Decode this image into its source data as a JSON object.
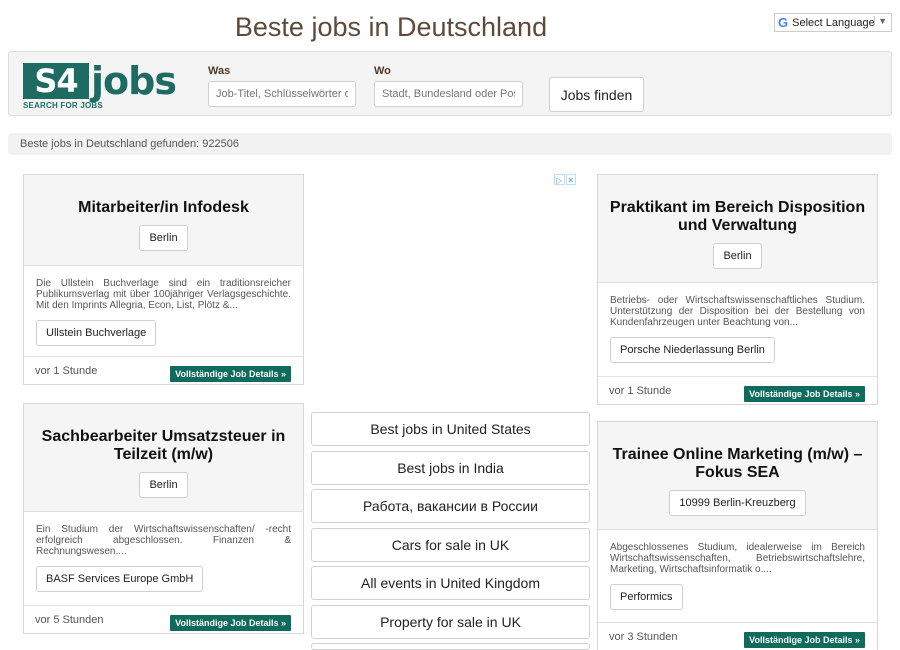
{
  "header": {
    "title": "Beste jobs in Deutschland"
  },
  "language": {
    "label": "Select Language"
  },
  "logo": {
    "main": "S4",
    "suffix": "jobs",
    "tagline": "SEARCH FOR JOBS"
  },
  "search": {
    "what_label": "Was",
    "what_placeholder": "Job-Titel, Schlüsselwörter o",
    "where_label": "Wo",
    "where_placeholder": "Stadt, Bundesland oder Pos",
    "button": "Jobs finden"
  },
  "results": {
    "text": "Beste jobs in Deutschland gefunden: 922506"
  },
  "details_label": "Vollständige Job Details »",
  "jobs": [
    {
      "title": "Mitarbeiter/in Infodesk",
      "location": "Berlin",
      "description": "Die Ullstein Buchverlage sind ein traditionsreicher Publikumsverlag mit über 100jähriger Verlagsgeschichte. Mit den Imprints Allegria, Econ, List, Plötz &...",
      "company": "Ullstein Buchverlage",
      "time": "vor 1 Stunde"
    },
    {
      "title": "Sachbearbeiter Umsatzsteuer in Teilzeit (m/w)",
      "location": "Berlin",
      "description": "Ein Studium der Wirtschaftswissenschaften/ -recht erfolgreich abgeschlossen. Finanzen & Rechnungswesen....",
      "company": "BASF Services Europe GmbH",
      "time": "vor 5 Stunden"
    },
    {
      "title": "Praktikant im Bereich Disposition und Verwaltung",
      "location": "Berlin",
      "description": "Betriebs- oder Wirtschaftswissenschaftliches Studium. Unterstützung der Disposition bei der Bestellung von Kundenfahrzeugen unter Beachtung von...",
      "company": "Porsche Niederlassung Berlin",
      "time": "vor 1 Stunde"
    },
    {
      "title": "Trainee Online Marketing (m/w) – Fokus SEA",
      "location": "10999 Berlin-Kreuzberg",
      "description": "Abgeschlossenes Studium, idealerweise im Bereich Wirtschaftswissenschaften, Betriebswirtschaftslehre, Marketing, Wirtschaftsinformatik o....",
      "company": "Performics",
      "time": "vor 3 Stunden"
    }
  ],
  "links": [
    "Best jobs in United States",
    "Best jobs in India",
    "Работа, вакансии в России",
    "Cars for sale in UK",
    "All events in United Kingdom",
    "Property for sale in UK"
  ]
}
